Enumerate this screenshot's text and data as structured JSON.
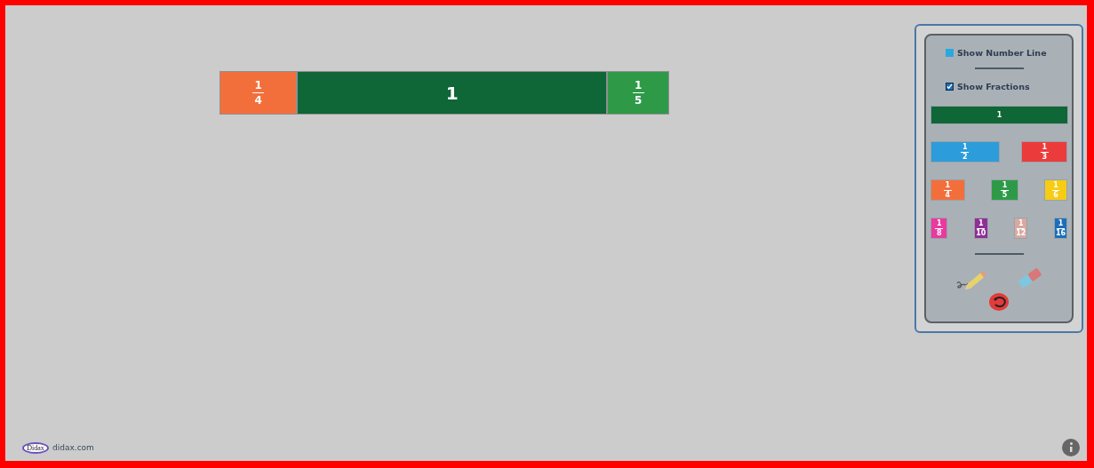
{
  "workspace": {
    "pieces": [
      {
        "kind": "fraction",
        "numerator": "1",
        "denominator": "4",
        "color": "#f26f3c"
      },
      {
        "kind": "whole",
        "label": "1",
        "color": "#0f6636"
      },
      {
        "kind": "fraction",
        "numerator": "1",
        "denominator": "5",
        "color": "#2e9a48"
      }
    ]
  },
  "panel": {
    "options": [
      {
        "label": "Show Number Line",
        "checked": false
      },
      {
        "label": "Show Fractions",
        "checked": true
      }
    ],
    "tile_rows": [
      [
        {
          "kind": "whole",
          "label": "1",
          "color": "#0f6636"
        }
      ],
      [
        {
          "kind": "fraction",
          "numerator": "1",
          "denominator": "2",
          "color": "#2d9cdb"
        },
        {
          "kind": "fraction",
          "numerator": "1",
          "denominator": "3",
          "color": "#ec3b3b"
        }
      ],
      [
        {
          "kind": "fraction",
          "numerator": "1",
          "denominator": "4",
          "color": "#f26f3c"
        },
        {
          "kind": "fraction",
          "numerator": "1",
          "denominator": "5",
          "color": "#2e9a48"
        },
        {
          "kind": "fraction",
          "numerator": "1",
          "denominator": "6",
          "color": "#f7cc14"
        }
      ],
      [
        {
          "kind": "fraction",
          "numerator": "1",
          "denominator": "8",
          "color": "#e93aa0"
        },
        {
          "kind": "fraction",
          "numerator": "1",
          "denominator": "10",
          "color": "#8e2f96"
        },
        {
          "kind": "fraction",
          "numerator": "1",
          "denominator": "12",
          "color": "#d9a9a0"
        },
        {
          "kind": "fraction",
          "numerator": "1",
          "denominator": "16",
          "color": "#1b6fb8"
        }
      ]
    ]
  },
  "footer": {
    "logo": "Didax",
    "site": "didax.com"
  }
}
